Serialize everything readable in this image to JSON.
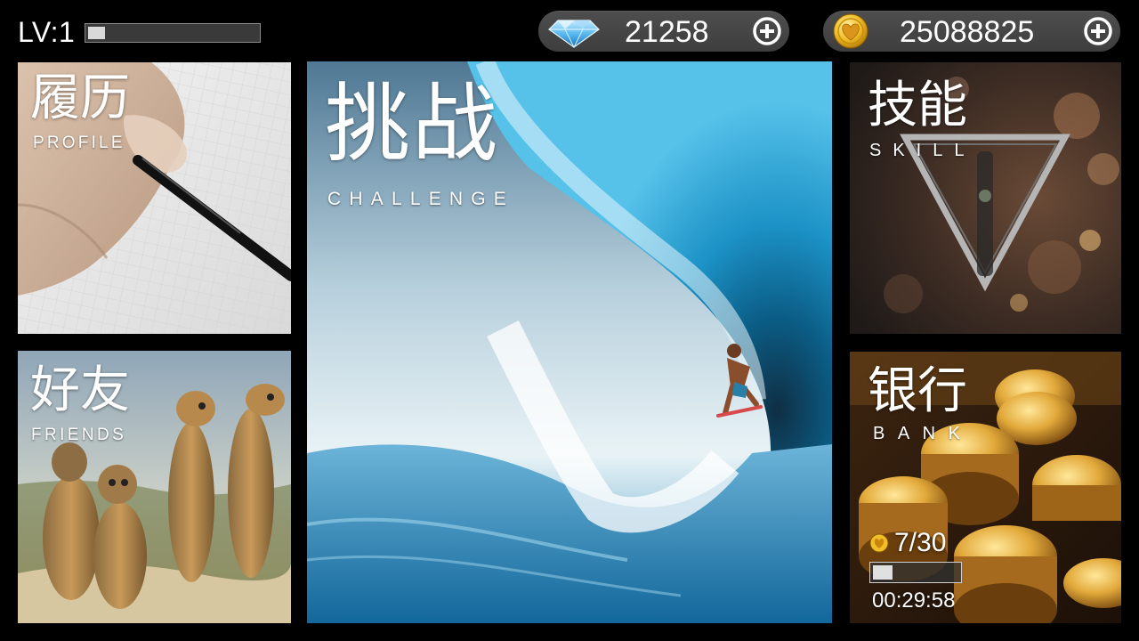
{
  "status": {
    "level_label": "LV:1",
    "xp_progress": 0.1
  },
  "currencies": {
    "gems": {
      "icon": "diamond-icon",
      "amount": "21258",
      "add_icon": "plus-circle-icon"
    },
    "coins": {
      "icon": "heart-coin-icon",
      "amount": "25088825",
      "add_icon": "plus-circle-icon"
    }
  },
  "tiles": {
    "profile": {
      "title": "履历",
      "subtitle": "PROFILE"
    },
    "friends": {
      "title": "好友",
      "subtitle": "FRIENDS"
    },
    "challenge": {
      "title": "挑战",
      "subtitle": "CHALLENGE"
    },
    "skill": {
      "title": "技能",
      "subtitle": "SKILL"
    },
    "bank": {
      "title": "银行",
      "subtitle": "BANK",
      "stamina": "7/30",
      "stamina_progress": 0.23,
      "timer": "00:29:58"
    }
  },
  "colors": {
    "background": "#000000",
    "pill": "#474747",
    "gem_blue": "#4fb3ee",
    "coin_gold": "#e8b21c",
    "wave_blue": "#1f8fc4"
  }
}
